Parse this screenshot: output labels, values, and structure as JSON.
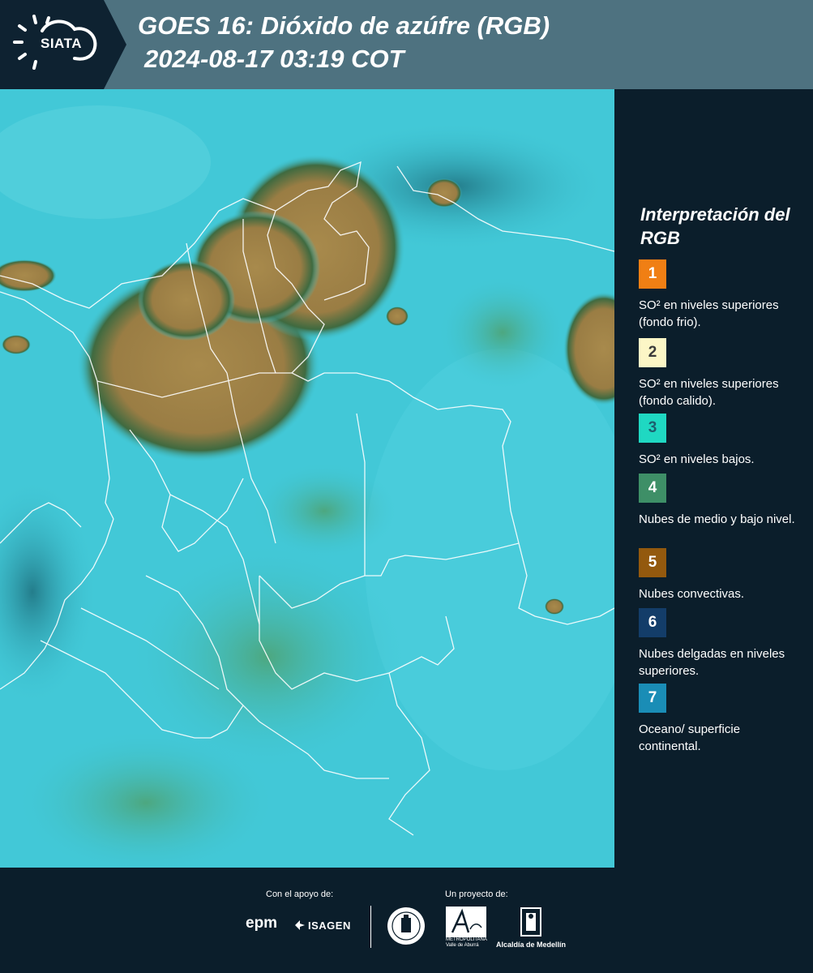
{
  "header": {
    "logo": "SIATA",
    "title": "GOES 16: Dióxido de azúfre (RGB)",
    "datetime": "2024-08-17 03:19 COT"
  },
  "legend": {
    "title": "Interpretación del RGB",
    "items": [
      {
        "number": "1",
        "color": "#f07f14",
        "text_color": "#ffffff",
        "description": "SO² en niveles superiores (fondo frio)."
      },
      {
        "number": "2",
        "color": "#fcf6c6",
        "text_color": "#3a3a3a",
        "description": "SO² en niveles superiores (fondo calido)."
      },
      {
        "number": "3",
        "color": "#1fd8c2",
        "text_color": "#1d5e6e",
        "description": "SO² en niveles bajos."
      },
      {
        "number": "4",
        "color": "#3e8f67",
        "text_color": "#ffffff",
        "description": "Nubes de medio y bajo nivel."
      },
      {
        "number": "5",
        "color": "#93590e",
        "text_color": "#ffffff",
        "description": "Nubes convectivas."
      },
      {
        "number": "6",
        "color": "#133d69",
        "text_color": "#ffffff",
        "description": "Nubes delgadas en niveles superiores."
      },
      {
        "number": "7",
        "color": "#1a8db6",
        "text_color": "#ffffff",
        "description": "Oceano/ superficie continental."
      }
    ]
  },
  "footer": {
    "support_label": "Con el apoyo de:",
    "project_label": "Un proyecto de:",
    "sponsors": [
      "epm",
      "ISAGEN"
    ],
    "area_caption_1": "METROPOLITANA",
    "area_caption_2": "Valle de Aburrá",
    "alcaldia": "Alcaldía de Medellín"
  }
}
